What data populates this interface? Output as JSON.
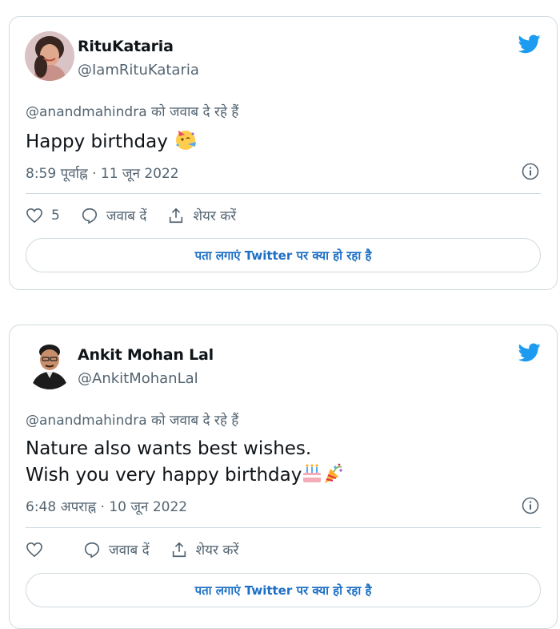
{
  "tweets": [
    {
      "author_name": "RituKataria",
      "handle": "@IamRituKataria",
      "reply_context": "@anandmahindra को जवाब दे रहे हैं",
      "text_lines": [
        "Happy birthday"
      ],
      "emojis": [
        "face-with-party-horn"
      ],
      "timestamp": "8:59 पूर्वाह्न · 11 जून 2022",
      "like_count": "5",
      "reply_label": "जवाब दें",
      "share_label": "शेयर करें",
      "cta_label": "पता लगाएं Twitter पर क्या हो रहा है",
      "accent": "#1d9bf0"
    },
    {
      "author_name": "Ankit Mohan Lal",
      "handle": "@AnkitMohanLal",
      "reply_context": "@anandmahindra को जवाब दे रहे हैं",
      "text_lines": [
        "Nature also wants best wishes.",
        "Wish you very happy birthday"
      ],
      "emojis": [
        "birthday-cake",
        "party-popper"
      ],
      "timestamp": "6:48 अपराह्न · 10 जून 2022",
      "like_count": "",
      "reply_label": "जवाब दें",
      "share_label": "शेयर करें",
      "cta_label": "पता लगाएं Twitter पर क्या हो रहा है",
      "accent": "#1d9bf0"
    }
  ]
}
